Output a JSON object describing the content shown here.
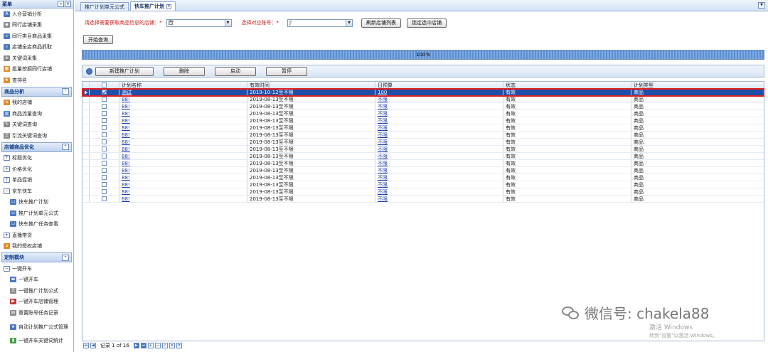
{
  "sidebar": {
    "title": "菜单",
    "top_items": [
      {
        "icon": "ai-icon",
        "label": "入仓营销分析"
      },
      {
        "icon": "eye-icon",
        "label": "同行店铺采集"
      },
      {
        "icon": "search-icon",
        "label": "同行类目商品采集"
      },
      {
        "icon": "search-icon",
        "label": "店铺全店商品抓取"
      },
      {
        "icon": "document-icon",
        "label": "关键词采集"
      },
      {
        "icon": "bulk-icon",
        "label": "批量挖掘同行店铺"
      },
      {
        "icon": "shop-icon",
        "label": "查排名"
      }
    ],
    "sections": [
      {
        "title": "商品分析",
        "items": [
          {
            "icon": "home-icon",
            "label": "我的店铺"
          },
          {
            "icon": "chart-icon",
            "label": "商品流量查询"
          },
          {
            "icon": "pen-icon",
            "label": "关键词查询"
          },
          {
            "icon": "list-icon",
            "label": "引流关键词查询"
          }
        ]
      },
      {
        "title": "店铺商品优化",
        "items": [
          {
            "icon": "plus-box-icon",
            "label": "标题优化",
            "level": 1
          },
          {
            "icon": "plus-box-icon",
            "label": "价格优化",
            "level": 1
          },
          {
            "icon": "plus-box-icon",
            "label": "单品促销",
            "level": 1
          },
          {
            "icon": "minus-box-icon",
            "label": "京东快车",
            "level": 1
          },
          {
            "icon": "window-icon",
            "label": "快车推广计划",
            "level": 2
          },
          {
            "icon": "window-icon",
            "label": "推广计划单元公式",
            "level": 2
          },
          {
            "icon": "window-icon",
            "label": "快车推广任务查看",
            "level": 2
          },
          {
            "icon": "plus-box-icon",
            "label": "直播带货",
            "level": 1
          },
          {
            "icon": "home-icon",
            "label": "我的授权店铺",
            "level": 1
          }
        ]
      },
      {
        "title": "定制模块",
        "items": [
          {
            "icon": "minus-box-icon",
            "label": "一键开车",
            "level": 1
          },
          {
            "icon": "car-icon",
            "label": "一键开车",
            "level": 2
          },
          {
            "icon": "list-icon",
            "label": "一键推广计划公式",
            "level": 2
          },
          {
            "icon": "play-icon",
            "label": "一键开车店铺管理",
            "level": 2
          },
          {
            "icon": "record-icon",
            "label": "重置账号任务记录",
            "level": 2
          },
          {
            "icon": "star-icon",
            "label": "自动计划推广公式管理",
            "level": 2,
            "tall": true
          },
          {
            "icon": "bar-icon",
            "label": "一键开车关键词统计",
            "level": 2
          }
        ]
      }
    ]
  },
  "tabs": [
    {
      "label": "推广计划单元公式",
      "active": false
    },
    {
      "label": "快车推广计划",
      "active": true
    }
  ],
  "form": {
    "shop_label": "请选择需要获取商品信息的店铺：*",
    "shop_value": "西'",
    "account_label": "选择对应账号：*",
    "account_value": "j'",
    "refresh_button": "刷新店铺列表",
    "lock_button": "锁定选中店铺",
    "start_button": "开始查询"
  },
  "progress": {
    "percent_label": "100%",
    "value": 100
  },
  "toolbar": {
    "new_button": "新建推广计划",
    "delete_button": "删除",
    "start_button": "启动",
    "pause_button": "暂停"
  },
  "grid": {
    "headers": {
      "name": "计划名称",
      "time": "有效时间",
      "budget": "日预算",
      "status": "状态",
      "type": "计划类型"
    },
    "rows": [
      {
        "name": "测试",
        "time": "2019-10-12至不限",
        "budget": "100",
        "status": "有效",
        "type": "商品",
        "selected": true,
        "checked": true
      },
      {
        "name": "88!",
        "time": "2019-08-13至不限",
        "budget": "不限",
        "status": "有效",
        "type": "商品"
      },
      {
        "name": "88!",
        "time": "2019-08-13至不限",
        "budget": "不限",
        "status": "有效",
        "type": "商品"
      },
      {
        "name": "88!",
        "time": "2019-08-13至不限",
        "budget": "不限",
        "status": "有效",
        "type": "商品"
      },
      {
        "name": "88!",
        "time": "2019-08-13至不限",
        "budget": "不限",
        "status": "有效",
        "type": "商品"
      },
      {
        "name": "88!",
        "time": "2019-08-13至不限",
        "budget": "不限",
        "status": "有效",
        "type": "商品"
      },
      {
        "name": "88!",
        "time": "2019-08-13至不限",
        "budget": "不限",
        "status": "有效",
        "type": "商品"
      },
      {
        "name": "88!",
        "time": "2019-08-13至不限",
        "budget": "不限",
        "status": "有效",
        "type": "商品"
      },
      {
        "name": "88!",
        "time": "2019-08-13至不限",
        "budget": "不限",
        "status": "有效",
        "type": "商品"
      },
      {
        "name": "88!",
        "time": "2019-08-13至不限",
        "budget": "不限",
        "status": "有效",
        "type": "商品"
      },
      {
        "name": "88!",
        "time": "2019-08-13至不限",
        "budget": "不限",
        "status": "有效",
        "type": "商品"
      },
      {
        "name": "88!",
        "time": "2019-08-13至不限",
        "budget": "不限",
        "status": "有效",
        "type": "商品"
      },
      {
        "name": "88!",
        "time": "2019-08-13至不限",
        "budget": "不限",
        "status": "有效",
        "type": "商品"
      },
      {
        "name": "88!",
        "time": "2019-08-13至不限",
        "budget": "不限",
        "status": "有效",
        "type": "商品"
      },
      {
        "name": "88!",
        "time": "2019-08-13至不限",
        "budget": "不限",
        "status": "有效",
        "type": "商品"
      },
      {
        "name": "88!",
        "time": "2019-08-13至不限",
        "budget": "不限",
        "status": "有效",
        "type": "商品"
      }
    ]
  },
  "pager": {
    "text": "记录 1 of 16"
  },
  "watermark": {
    "text": "微信号: chakela88"
  },
  "activation": {
    "line1": "激活 Windows",
    "line2": "转到\"设置\"以激活 Windows。"
  },
  "colors": {
    "selected_row": "#1f4fa8",
    "highlight_border": "#e02020",
    "link": "#1a3fb3",
    "required_label": "#d01c1c"
  }
}
